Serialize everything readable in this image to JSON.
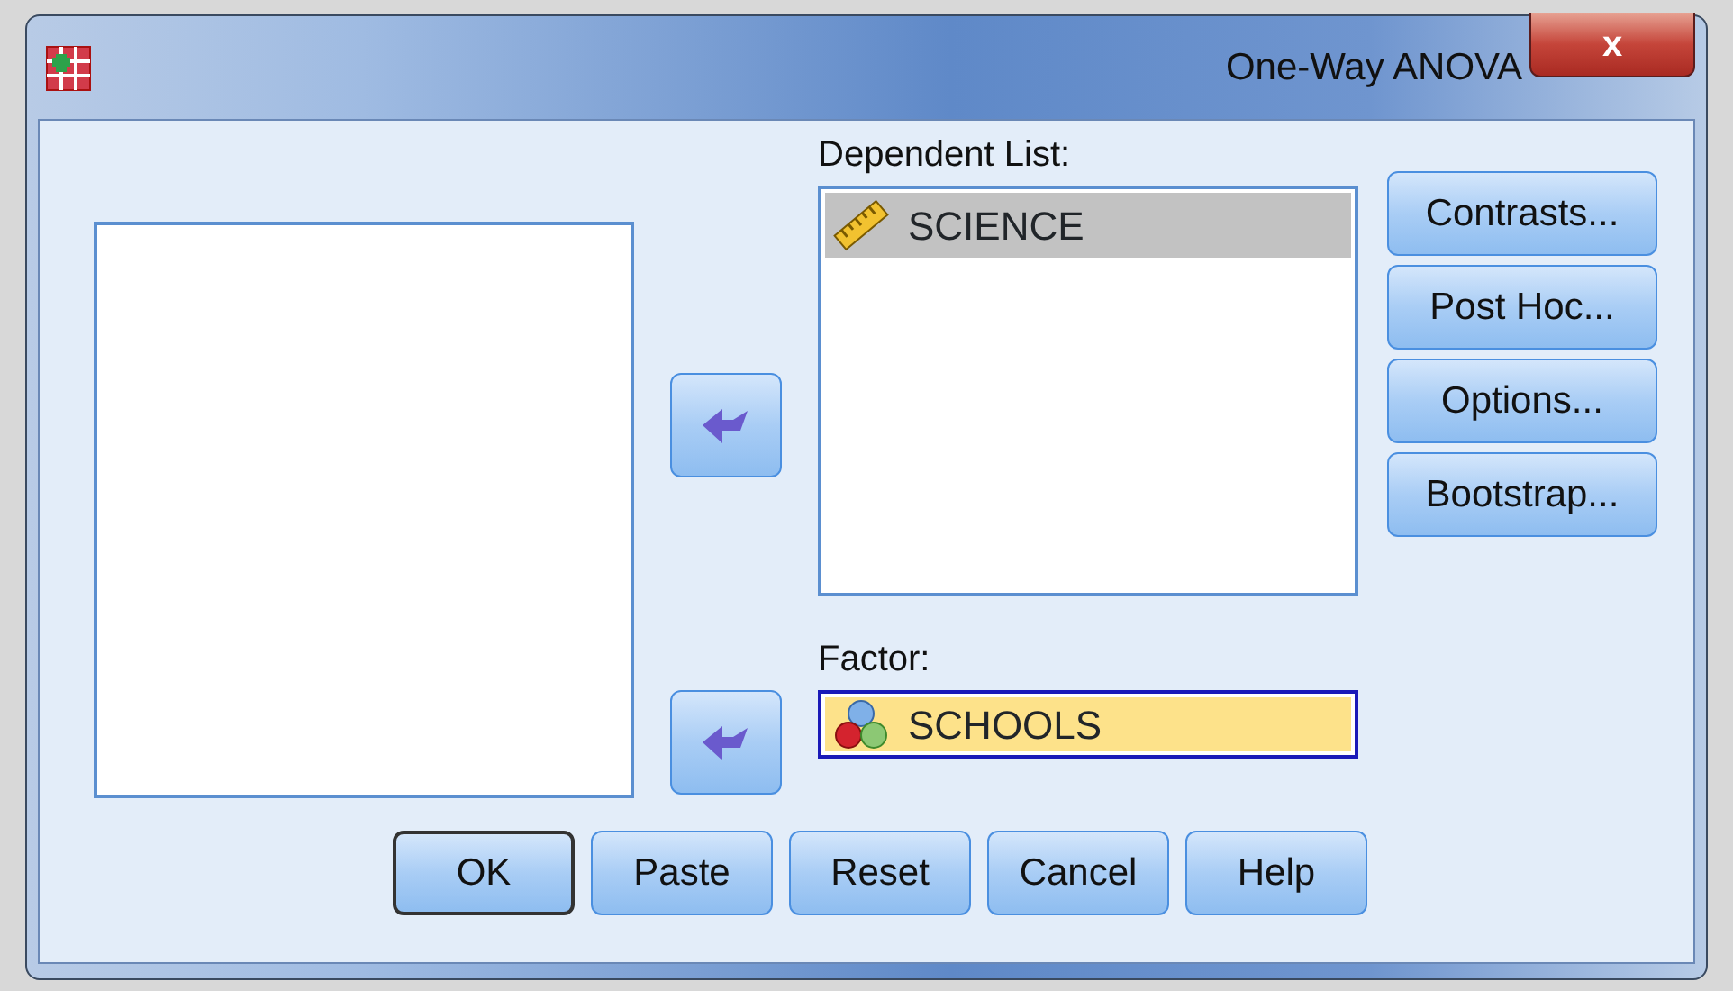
{
  "window": {
    "title": "One-Way ANOVA",
    "close_label": "x"
  },
  "dependent_list": {
    "label": "Dependent List:",
    "items": [
      {
        "name": "SCIENCE",
        "kind": "scale",
        "selected": true
      }
    ]
  },
  "factor": {
    "label": "Factor:",
    "value": "SCHOOLS",
    "kind": "nominal",
    "selected": true
  },
  "side_buttons": [
    {
      "label": "Contrasts..."
    },
    {
      "label": "Post Hoc..."
    },
    {
      "label": "Options..."
    },
    {
      "label": "Bootstrap..."
    }
  ],
  "buttons": [
    {
      "label": "OK",
      "default": true
    },
    {
      "label": "Paste",
      "default": false
    },
    {
      "label": "Reset",
      "default": false
    },
    {
      "label": "Cancel",
      "default": false
    },
    {
      "label": "Help",
      "default": false
    }
  ]
}
